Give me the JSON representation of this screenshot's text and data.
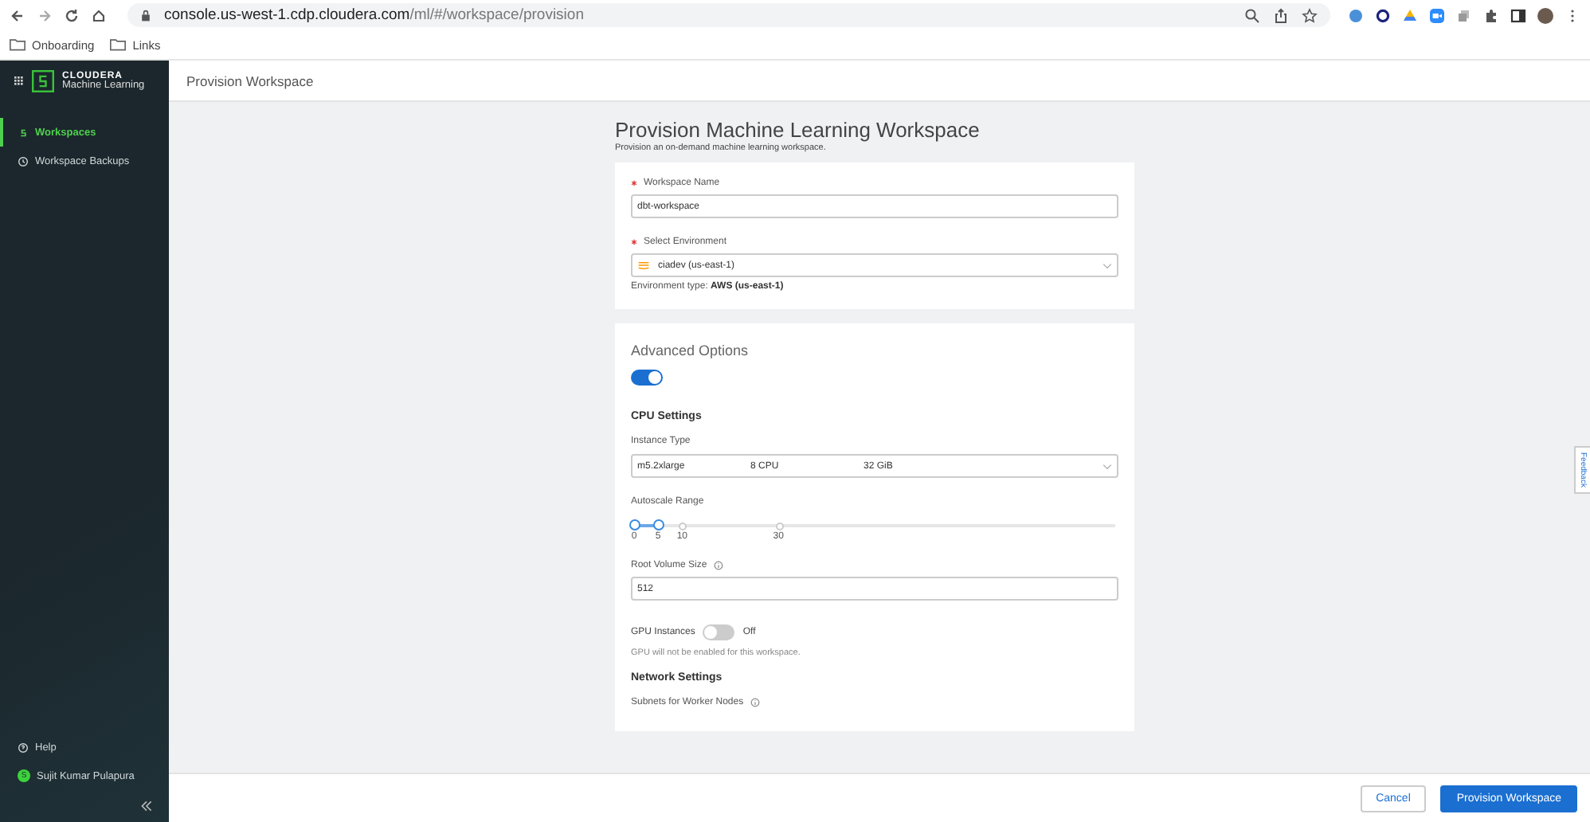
{
  "browser": {
    "url_host": "console.us-west-1.cdp.cloudera.com",
    "url_path": "/ml/#/workspace/provision",
    "bookmarks": [
      "Onboarding",
      "Links"
    ]
  },
  "sidebar": {
    "brand": "CLOUDERA",
    "product": "Machine Learning",
    "items": [
      {
        "label": "Workspaces",
        "selected": true
      },
      {
        "label": "Workspace Backups",
        "selected": false
      }
    ],
    "help": "Help",
    "user": {
      "initial": "S",
      "name": "Sujit Kumar Pulapura"
    }
  },
  "header": {
    "title": "Provision Workspace"
  },
  "page": {
    "title": "Provision Machine Learning Workspace",
    "subtitle": "Provision an on-demand machine learning workspace."
  },
  "basics": {
    "workspace_name": {
      "label": "Workspace Name",
      "required": true,
      "value": "dbt-workspace"
    },
    "environment": {
      "label": "Select Environment",
      "required": true,
      "value": "ciadev (us-east-1)",
      "type_label": "Environment type: ",
      "type_value": "AWS (us-east-1)"
    }
  },
  "advanced": {
    "title": "Advanced Options",
    "on": true,
    "cpu_title": "CPU Settings",
    "instance_type": {
      "label": "Instance Type",
      "name": "m5.2xlarge",
      "cpu": "8 CPU",
      "memory": "32 GiB"
    },
    "autoscale": {
      "label": "Autoscale Range",
      "handles": [
        {
          "level": 0
        },
        {
          "level": 0.05
        }
      ],
      "marks": [
        {
          "text": "0",
          "level": 0
        },
        {
          "text": "5",
          "level": 0.05
        },
        {
          "text": "10",
          "level": 0.1
        },
        {
          "text": "30",
          "level": 0.3
        }
      ]
    },
    "root_volume": {
      "label": "Root Volume Size",
      "value": "512"
    },
    "gpu": {
      "label": "GPU Instances",
      "on": false,
      "state_text": "Off",
      "note": "GPU will not be enabled for this workspace."
    },
    "network_title": "Network Settings",
    "subnets_label": "Subnets for Worker Nodes"
  },
  "feedback": "Feedback",
  "footer": {
    "cancel": "Cancel",
    "submit": "Provision Workspace"
  }
}
